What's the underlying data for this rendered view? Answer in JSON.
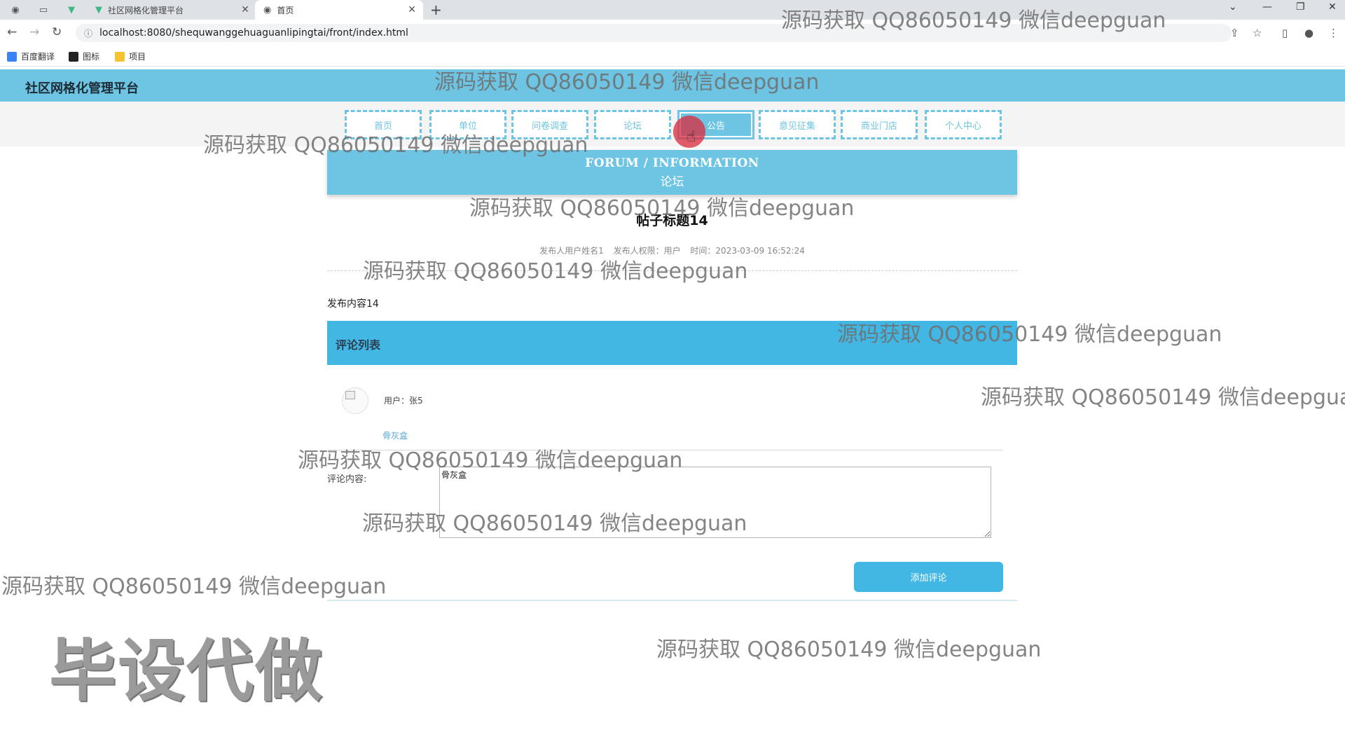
{
  "browser": {
    "tabs": [
      {
        "title": "社区网格化管理平台",
        "favicon": "vue-v-icon",
        "active": false
      },
      {
        "title": "首页",
        "favicon": "globe-icon",
        "active": true
      }
    ],
    "new_tab_label": "+",
    "url": "localhost:8080/shequwanggehuaguanlipingtai/front/index.html",
    "bookmarks": [
      "百度翻译",
      "图标",
      "项目"
    ]
  },
  "site": {
    "title": "社区网格化管理平台",
    "nav": [
      "首页",
      "单位",
      "问卷调查",
      "论坛",
      "公告",
      "意见征集",
      "商业门店",
      "个人中心"
    ],
    "active_nav": "公告"
  },
  "banner": {
    "en": "FORUM / INFORMATION",
    "zh": "论坛"
  },
  "post": {
    "title": "帖子标题14",
    "author": "发布人用户姓名1",
    "role": "发布人权限：用户",
    "time": "时间：2023-03-09 16:52:24",
    "content": "发布内容14"
  },
  "comments": {
    "header": "评论列表",
    "items": [
      {
        "user": "用户：张5",
        "text": "骨灰盒"
      }
    ]
  },
  "form": {
    "label": "评论内容:",
    "value": "骨灰盒",
    "submit_label": "添加评论"
  },
  "watermarks": {
    "text": "源码获取 QQ86050149 微信deepguan",
    "big": "毕设代做"
  },
  "colors": {
    "primary": "#6dc5e3",
    "comment_bar": "#43b7e4",
    "button": "#43b7e4"
  }
}
